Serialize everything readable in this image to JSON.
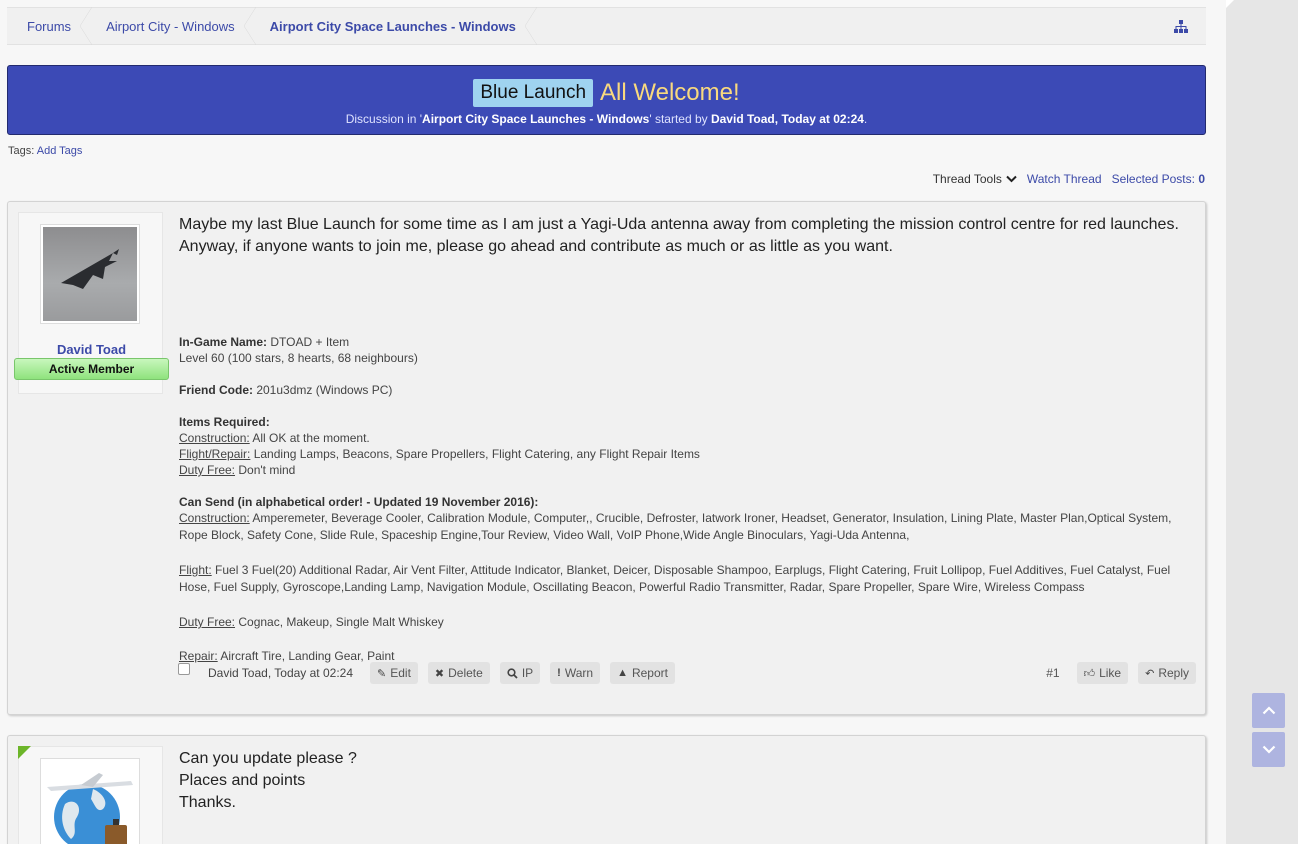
{
  "breadcrumb": {
    "items": [
      "Forums",
      "Airport City - Windows",
      "Airport City Space Launches - Windows"
    ]
  },
  "thread": {
    "prefix": "Blue Launch",
    "title": "All Welcome!",
    "discussion_prefix": "Discussion in '",
    "forum": "Airport City Space Launches - Windows",
    "started_by": "' started by ",
    "author": "David Toad",
    "time": "Today at 02:24",
    "sep": ", ",
    "end": "."
  },
  "tags": {
    "label": "Tags:",
    "add": "Add Tags"
  },
  "tools": {
    "thread_tools": "Thread Tools",
    "watch": "Watch Thread",
    "selected_label": "Selected Posts:",
    "selected_count": "0"
  },
  "post1": {
    "username": "David Toad",
    "user_title": "Active Member",
    "lead": "Maybe my last Blue Launch for some time as I am just a Yagi-Uda antenna away from completing the mission control centre for red launches. Anyway, if anyone wants to join me, please go ahead and contribute as much or as little as you want.",
    "ign_label": "In-Game Name:",
    "ign_value": " DTOAD + Item",
    "level": "Level 60 (100 stars, 8 hearts, 68 neighbours)",
    "fc_label": "Friend Code:",
    "fc_value": " 201u3dmz (Windows PC)",
    "req_label": "Items Required:",
    "req_construction_label": "Construction:",
    "req_construction": " All OK at the moment.",
    "req_flight_label": "Flight/Repair:",
    "req_flight": " Landing Lamps, Beacons, Spare Propellers, Flight Catering, any Flight Repair Items",
    "req_duty_label": "Duty Free:",
    "req_duty": " Don't mind",
    "send_label": "Can Send (in alphabetical order! - Updated 19 November 2016):",
    "send_construction_label": "Construction:",
    "send_construction": " Amperemeter, Beverage Cooler, Calibration Module, Computer,, Crucible, Defroster, Iatwork Ironer, Headset, Generator, Insulation, Lining Plate, Master Plan,Optical System, Rope Block, Safety Cone, Slide Rule, Spaceship Engine,Tour Review, Video Wall, VoIP Phone,Wide Angle Binoculars, Yagi-Uda Antenna,",
    "send_flight_label": "Flight:",
    "send_flight": " Fuel 3 Fuel(20) Additional Radar, Air Vent Filter, Attitude Indicator, Blanket, Deicer, Disposable Shampoo, Earplugs, Flight Catering, Fruit Lollipop, Fuel Additives, Fuel Catalyst, Fuel Hose, Fuel Supply, Gyroscope,Landing Lamp, Navigation Module, Oscillating Beacon, Powerful Radio Transmitter, Radar, Spare Propeller, Spare Wire, Wireless Compass",
    "send_duty_label": "Duty Free:",
    "send_duty": " Cognac, Makeup, Single Malt Whiskey",
    "send_repair_label": "Repair:",
    "send_repair": " Aircraft Tire, Landing Gear, Paint",
    "footer_meta": "David Toad, Today at 02:24",
    "actions": {
      "edit": "Edit",
      "delete": "Delete",
      "ip": "IP",
      "warn": "Warn",
      "report": "Report"
    },
    "post_number": "#1",
    "like": "Like",
    "reply": "Reply"
  },
  "post2": {
    "line1": "Can you update please ?",
    "line2": "Places and points",
    "line3": "Thanks."
  },
  "colors": {
    "accent": "#3c4aa8",
    "banner": "#3c4ab6",
    "title": "#f9d97e",
    "prefix_bg": "#9fd3f0",
    "member_badge": "#8fe37d"
  }
}
